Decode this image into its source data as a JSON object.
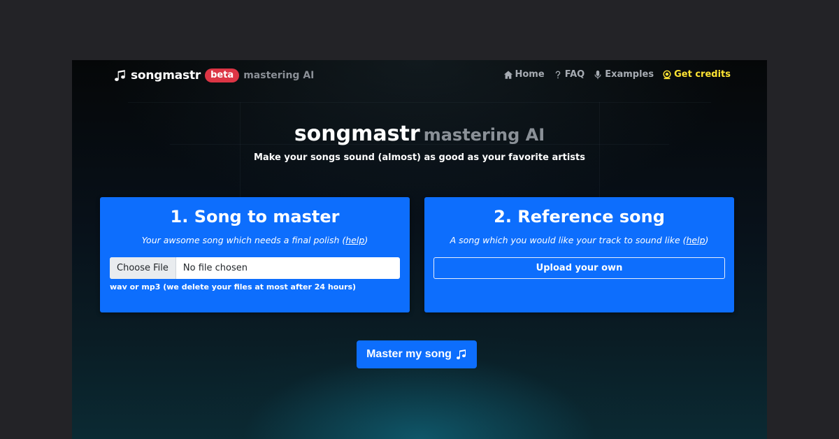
{
  "nav": {
    "brand": {
      "icon": "music-note-icon",
      "name": "songmastr",
      "badge": "beta",
      "subtitle": "mastering AI"
    },
    "links": [
      {
        "icon": "house-icon",
        "label": "Home"
      },
      {
        "icon": "question-icon",
        "label": "FAQ"
      },
      {
        "icon": "microphone-icon",
        "label": "Examples"
      },
      {
        "icon": "coin-icon",
        "label": "Get credits"
      }
    ]
  },
  "hero": {
    "title": "songmastr",
    "title_suffix": "mastering AI",
    "subtitle": "Make your songs sound (almost) as good as your favorite artists"
  },
  "song_card": {
    "title": "1. Song to master",
    "description": "Your awsome song which needs a final polish (",
    "help_link": "help",
    "description_end": ")",
    "file_button": "Choose File",
    "file_status": "No file chosen",
    "note": "wav or mp3 (we delete your files at most after 24 hours)"
  },
  "reference_card": {
    "title": "2. Reference song",
    "description": "A song which you would like your track to sound like (",
    "help_link": "help",
    "description_end": ")",
    "upload_button": "Upload your own"
  },
  "submit": {
    "label": "Master my song",
    "icon": "music-note-icon"
  },
  "colors": {
    "primary": "#0d6efd",
    "badge": "#dc3545",
    "credits": "#ffe433",
    "muted": "#8a9097"
  }
}
